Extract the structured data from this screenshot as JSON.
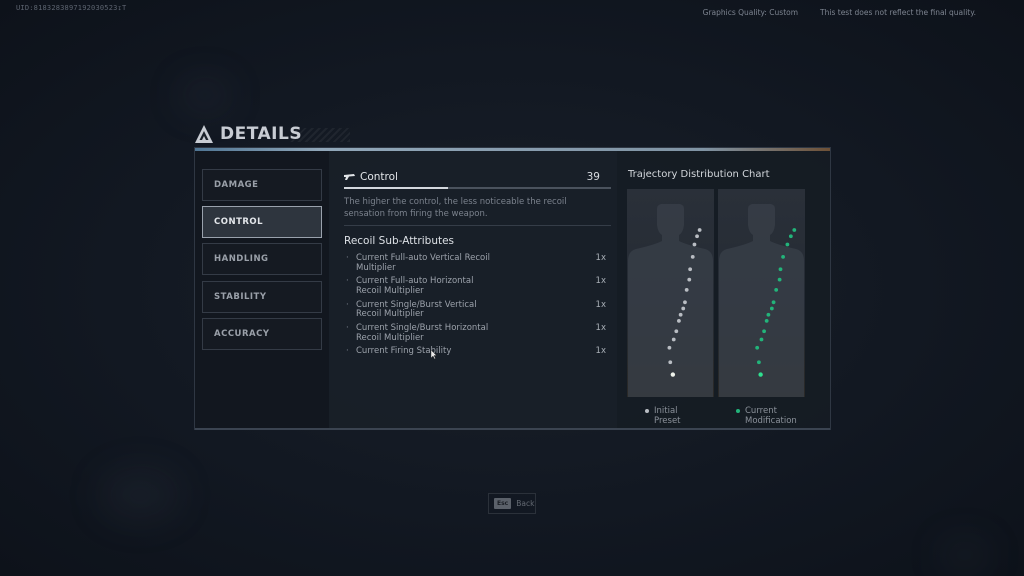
{
  "header": {
    "uid": "UID:8183283897192030523↧T",
    "graphics_quality": "Graphics Quality: Custom",
    "disclaimer": "This test does not reflect the final quality."
  },
  "panel": {
    "title": "DETAILS",
    "title_icon": "triangle-emblem-icon",
    "tabs": [
      {
        "label": "DAMAGE",
        "active": false
      },
      {
        "label": "CONTROL",
        "active": true
      },
      {
        "label": "HANDLING",
        "active": false
      },
      {
        "label": "STABILITY",
        "active": false
      },
      {
        "label": "ACCURACY",
        "active": false
      }
    ]
  },
  "attribute": {
    "icon": "gun-icon",
    "name": "Control",
    "value": "39",
    "bar_fraction": 0.39,
    "description": "The higher the control, the less noticeable the recoil sensation from firing the weapon."
  },
  "sub_attributes": {
    "title": "Recoil Sub-Attributes",
    "items": [
      {
        "label": "Current Full-auto Vertical Recoil Multiplier",
        "value": "1x"
      },
      {
        "label": "Current Full-auto Horizontal Recoil Multiplier",
        "value": "1x"
      },
      {
        "label": "Current Single/Burst Vertical Recoil Multiplier",
        "value": "1x"
      },
      {
        "label": "Current Single/Burst Horizontal Recoil Multiplier",
        "value": "1x"
      },
      {
        "label": "Current Firing Stability",
        "value": "1x"
      }
    ]
  },
  "chart": {
    "title": "Trajectory Distribution Chart",
    "legend": [
      {
        "label": "Initial Preset",
        "color": "#b9bdc3"
      },
      {
        "label": "Current Modification",
        "color": "#22b47a"
      }
    ]
  },
  "chart_data": {
    "type": "scatter",
    "title": "Trajectory Distribution Chart",
    "note": "Shot impact pattern relative to target; x = horizontal offset (right positive), y = vertical climb (shot order bottom to top); units relative to target silhouette (0-1)",
    "series": [
      {
        "name": "Initial Preset",
        "color": "#b9bdc3",
        "points": [
          [
            0.5,
            0.1
          ],
          [
            0.47,
            0.16
          ],
          [
            0.46,
            0.23
          ],
          [
            0.51,
            0.27
          ],
          [
            0.54,
            0.31
          ],
          [
            0.57,
            0.36
          ],
          [
            0.59,
            0.39
          ],
          [
            0.62,
            0.42
          ],
          [
            0.64,
            0.45
          ],
          [
            0.66,
            0.51
          ],
          [
            0.69,
            0.56
          ],
          [
            0.7,
            0.61
          ],
          [
            0.73,
            0.67
          ],
          [
            0.75,
            0.73
          ],
          [
            0.78,
            0.77
          ],
          [
            0.81,
            0.8
          ]
        ]
      },
      {
        "name": "Current Modification",
        "color": "#22b47a",
        "points": [
          [
            0.47,
            0.1
          ],
          [
            0.45,
            0.16
          ],
          [
            0.43,
            0.23
          ],
          [
            0.48,
            0.27
          ],
          [
            0.51,
            0.31
          ],
          [
            0.54,
            0.36
          ],
          [
            0.56,
            0.39
          ],
          [
            0.6,
            0.42
          ],
          [
            0.62,
            0.45
          ],
          [
            0.65,
            0.51
          ],
          [
            0.69,
            0.56
          ],
          [
            0.7,
            0.61
          ],
          [
            0.73,
            0.67
          ],
          [
            0.78,
            0.73
          ],
          [
            0.82,
            0.77
          ],
          [
            0.86,
            0.8
          ]
        ]
      }
    ]
  },
  "footer": {
    "esc_key": "Esc",
    "back_label": "Back"
  },
  "colors": {
    "accent_green": "#22b47a",
    "initial_grey": "#b9bdc3",
    "panel_bg": "#161c24"
  }
}
